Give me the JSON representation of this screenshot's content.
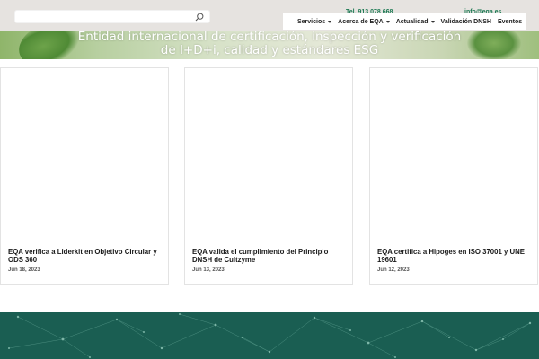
{
  "search": {
    "placeholder": ""
  },
  "contact": {
    "phone": "Tel. 913 078 668",
    "email": "info@eqa.es"
  },
  "nav": [
    {
      "label": "Servicios",
      "dropdown": true
    },
    {
      "label": "Acerca de EQA",
      "dropdown": true
    },
    {
      "label": "Actualidad",
      "dropdown": true
    },
    {
      "label": "Validación DNSH",
      "dropdown": false
    },
    {
      "label": "Eventos",
      "dropdown": false
    }
  ],
  "banner": {
    "title": "Entidad internacional de certificación, inspección y verificación de I+D+i, calidad y estándares ESG"
  },
  "posts": [
    {
      "title": "EQA verifica a Liderkit en Objetivo Circular y ODS 360",
      "date": "Jun 18, 2023"
    },
    {
      "title": "EQA valida el cumplimiento del Principio DNSH de Cultzyme",
      "date": "Jun 13, 2023"
    },
    {
      "title": "EQA certifica a Hipoges en ISO 37001 y UNE 19601",
      "date": "Jun 12, 2023"
    }
  ],
  "colors": {
    "accent": "#1e7a54",
    "footer": "#1a5e52",
    "topbar": "#e6e3e0"
  },
  "icons": {
    "search": "search-icon",
    "dropdown": "chevron-down-icon"
  }
}
